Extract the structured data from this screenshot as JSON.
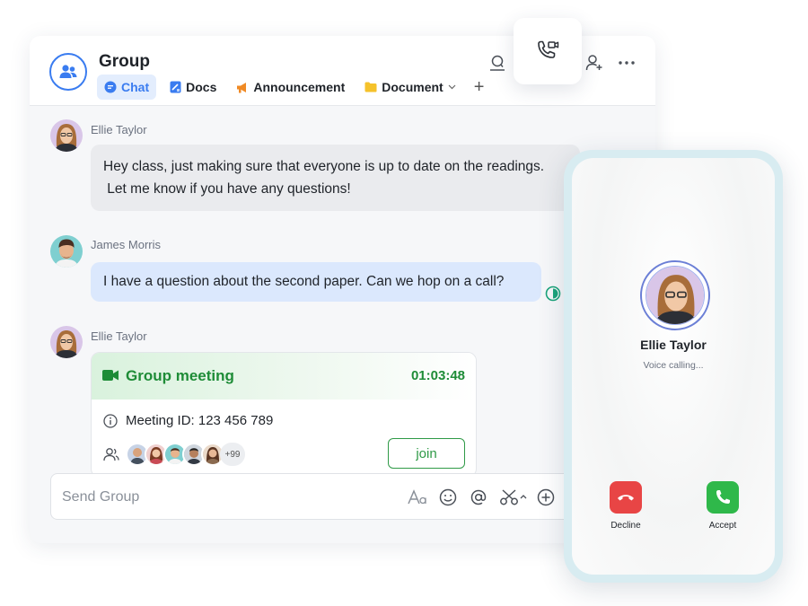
{
  "header": {
    "title": "Group",
    "tabs": [
      {
        "label": "Chat",
        "icon": "chat-bubble-icon",
        "active": true
      },
      {
        "label": "Docs",
        "icon": "docs-icon"
      },
      {
        "label": "Announcement",
        "icon": "megaphone-icon"
      },
      {
        "label": "Document",
        "icon": "folder-icon",
        "dropdown": true
      }
    ],
    "add_tab_label": "+",
    "icons": [
      "search-user-icon",
      "video-call-icon",
      "add-user-icon",
      "more-icon"
    ]
  },
  "messages": [
    {
      "sender": "Ellie Taylor",
      "lines": [
        "Hey class, just making sure that everyone is up to date on the readings.",
        " Let me know if you have any questions!"
      ]
    },
    {
      "sender": "James Morris",
      "text": "I have a question about the second paper. Can we hop on a call?"
    },
    {
      "sender": "Ellie Taylor",
      "meeting": {
        "title": "Group meeting",
        "duration": "01:03:48",
        "meeting_id": "Meeting ID: 123 456 789",
        "participants_more": "+99",
        "join_label": "join"
      }
    }
  ],
  "composer": {
    "placeholder": "Send Group",
    "icons": [
      "font-format-icon",
      "emoji-icon",
      "mention-icon",
      "scissors-icon",
      "add-circle-icon"
    ]
  },
  "incoming_call": {
    "caller_name": "Ellie Taylor",
    "status": "Voice calling...",
    "decline_label": "Decline",
    "accept_label": "Accept"
  },
  "colors": {
    "accent": "#3a7cf0",
    "meeting_green": "#1e8c37",
    "decline_red": "#e84545",
    "accept_green": "#2fb84a"
  }
}
